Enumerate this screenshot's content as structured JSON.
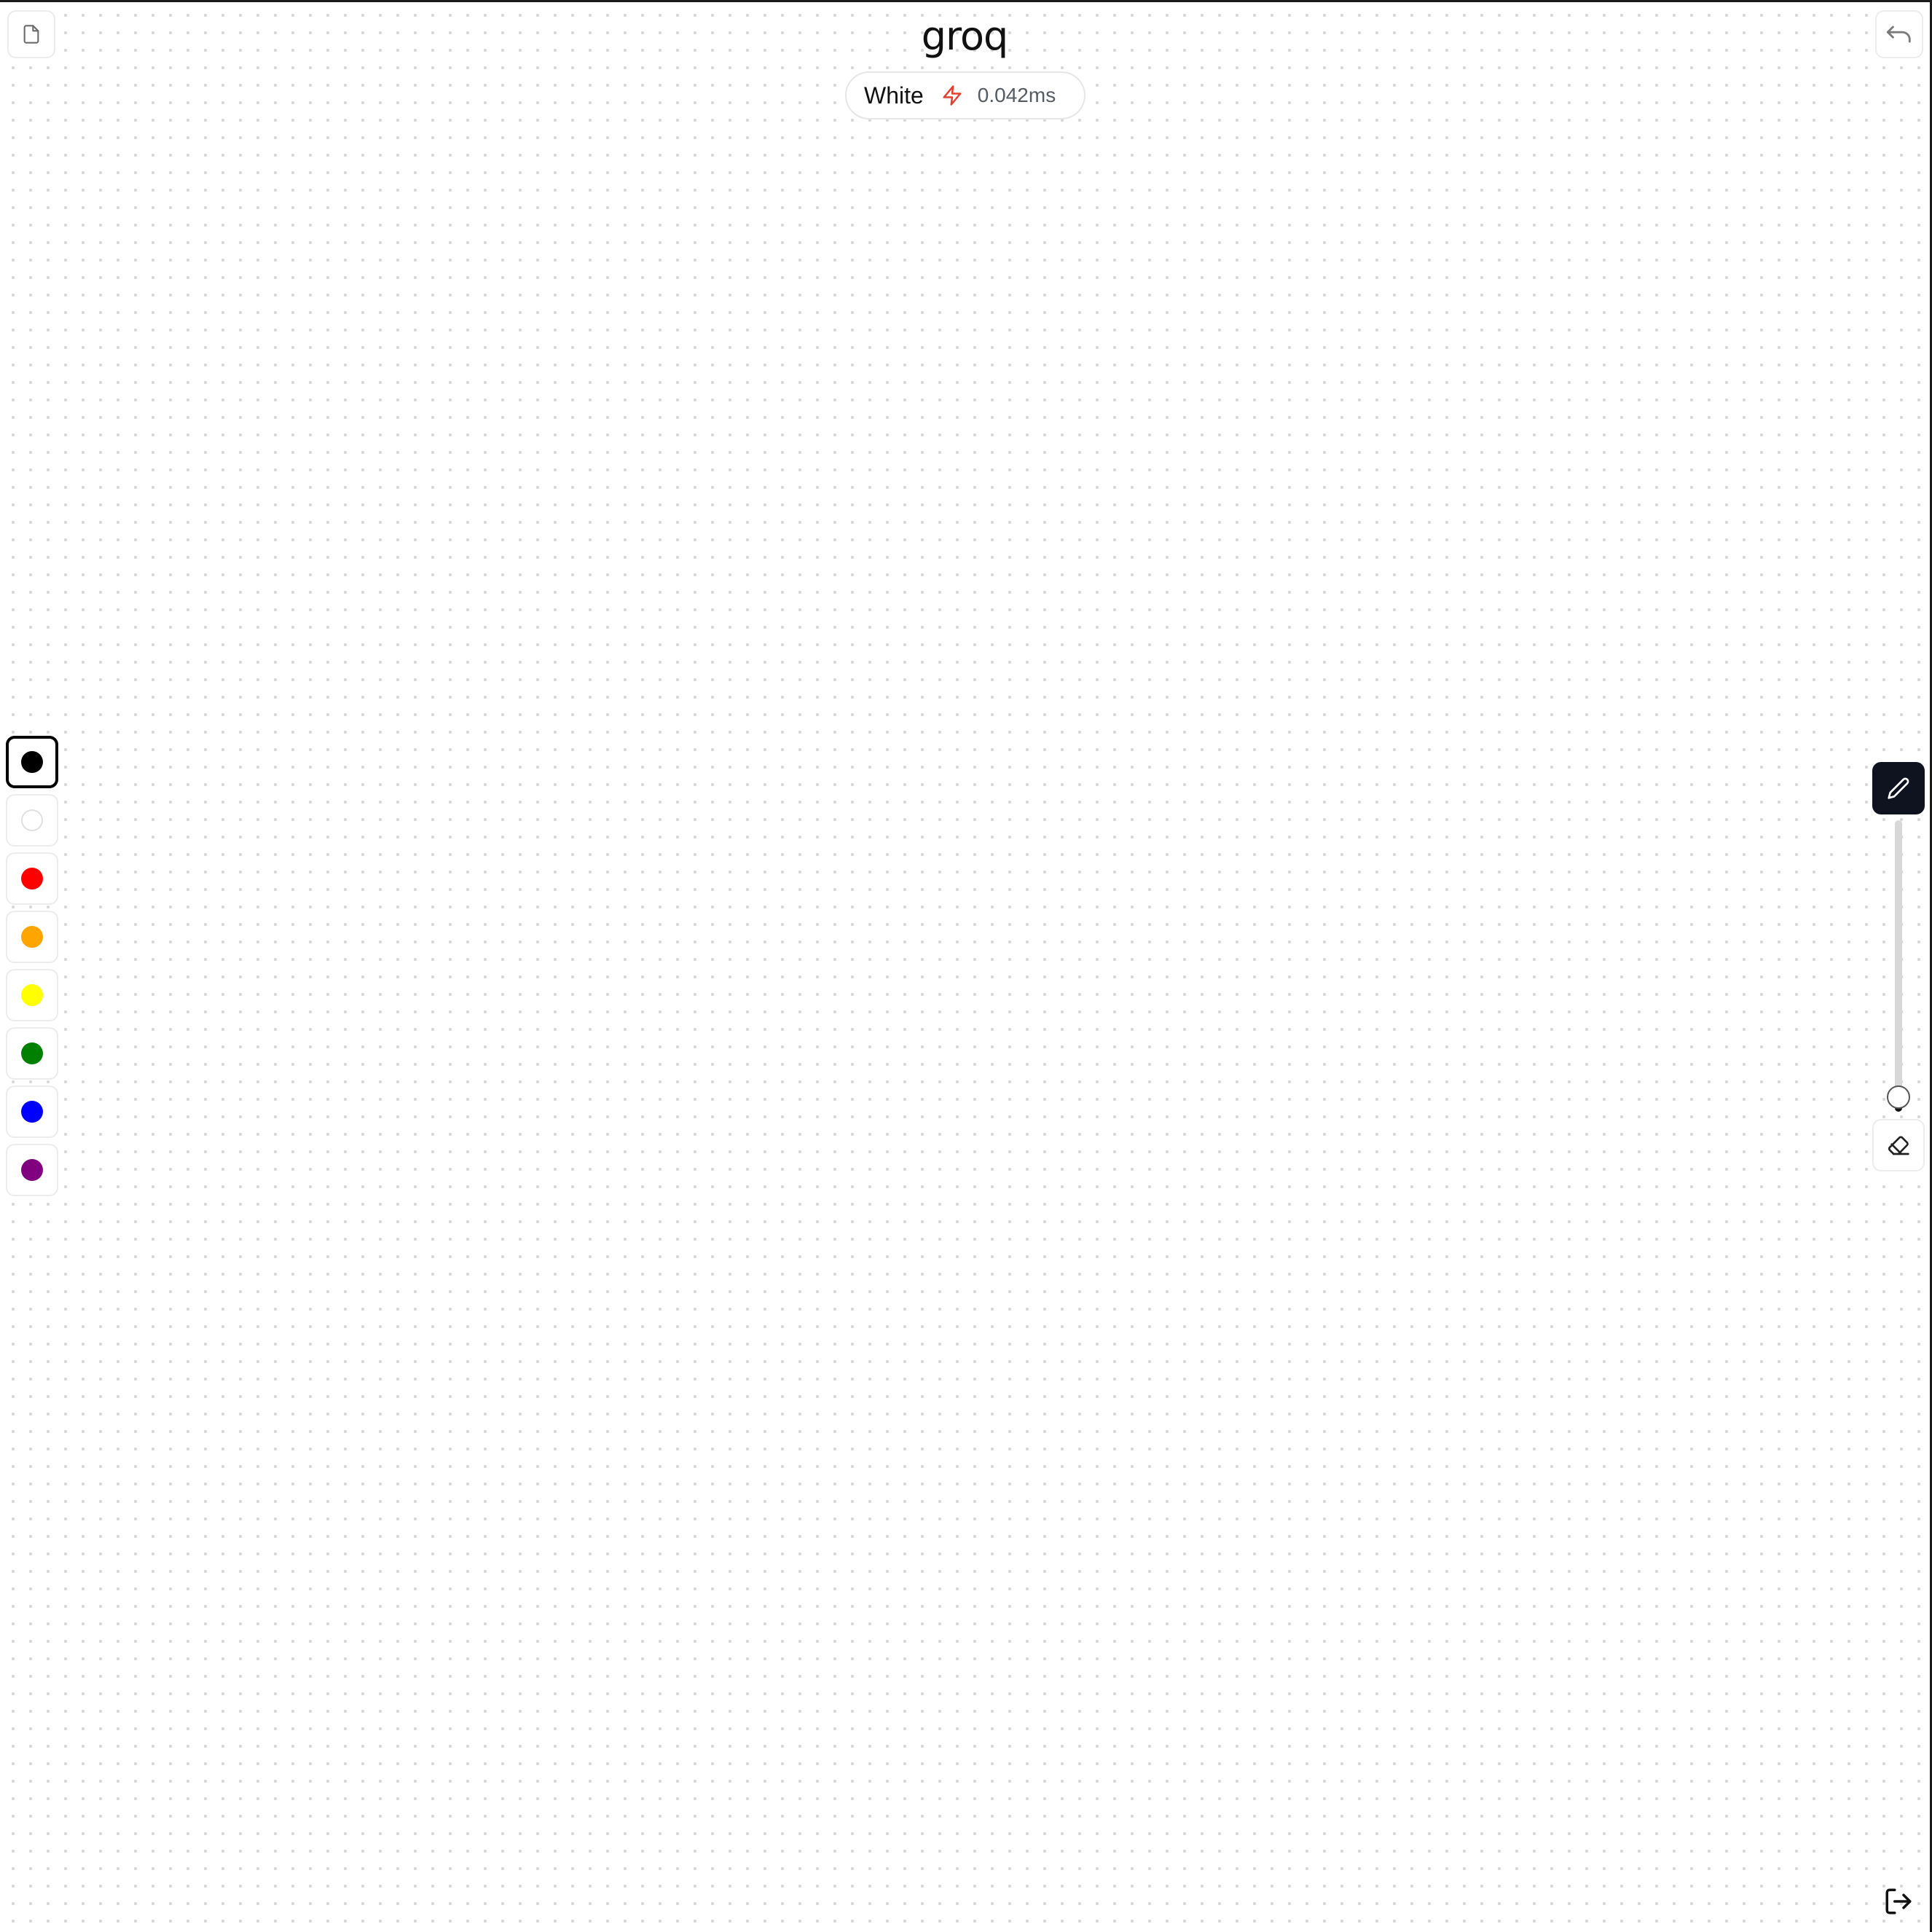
{
  "app": {
    "logo_text": "groq"
  },
  "toolbar": {
    "new_document_icon": "file-icon",
    "undo_icon": "undo-icon",
    "logout_icon": "logout-icon"
  },
  "status": {
    "color_name": "White",
    "latency": "0.042ms",
    "bolt_icon": "zap-icon",
    "bolt_color": "#e5402f"
  },
  "palette": {
    "selected_index": 0,
    "colors": [
      {
        "name": "black",
        "hex": "#000000"
      },
      {
        "name": "white",
        "hex": "#ffffff"
      },
      {
        "name": "red",
        "hex": "#ff0000"
      },
      {
        "name": "orange",
        "hex": "#ffa500"
      },
      {
        "name": "yellow",
        "hex": "#ffff00"
      },
      {
        "name": "green",
        "hex": "#008000"
      },
      {
        "name": "blue",
        "hex": "#0000ff"
      },
      {
        "name": "purple",
        "hex": "#800080"
      }
    ]
  },
  "tools": {
    "active": "pen",
    "pen_icon": "pencil-icon",
    "eraser_icon": "eraser-icon",
    "brush_size_fraction": 0.05
  }
}
